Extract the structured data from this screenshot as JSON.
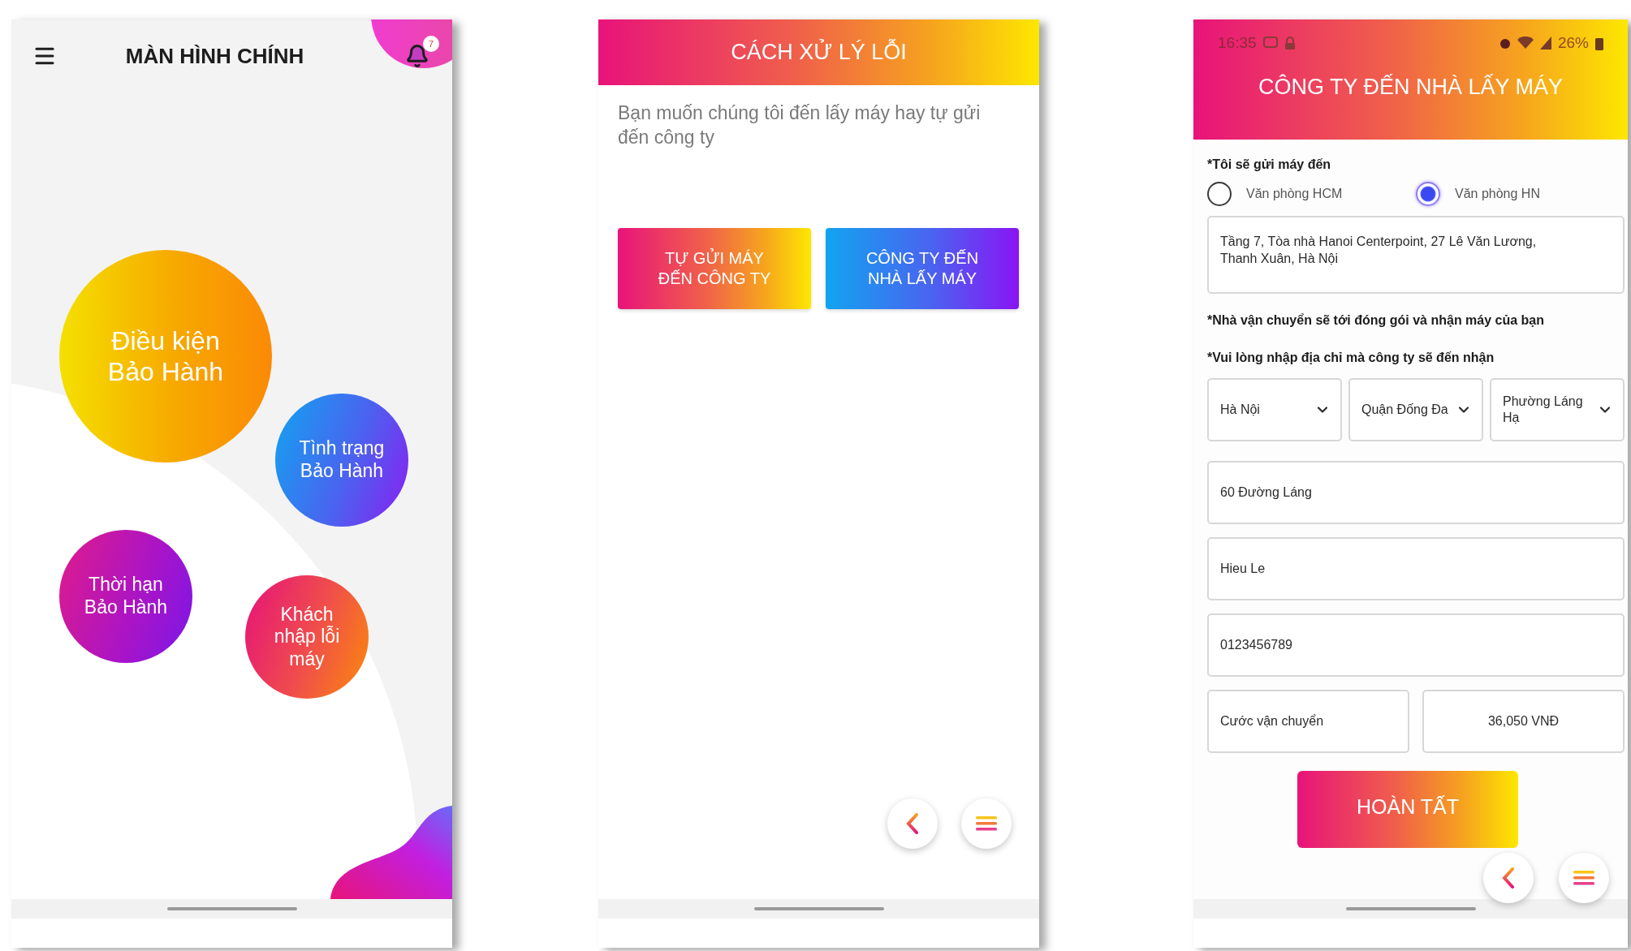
{
  "main_screen": {
    "title": "MÀN HÌNH CHÍNH",
    "notification_count": "7",
    "bubbles": [
      {
        "label": "Điều kiện Bảo Hành",
        "kind": "sunset"
      },
      {
        "label": "Tình trạng Bảo Hành",
        "kind": "ocean"
      },
      {
        "label": "Thời hạn Bảo Hành",
        "kind": "orchid"
      },
      {
        "label": "Khách nhập lỗi máy",
        "kind": "flame"
      }
    ]
  },
  "error_screen": {
    "title": "CÁCH XỬ LÝ LỖI",
    "prompt": "Bạn muốn chúng tôi đến lấy máy hay tự gửi đến công ty",
    "options": [
      {
        "label": "TỰ GỬI MÁY ĐẾN CÔNG TY",
        "kind": "warm"
      },
      {
        "label": "CÔNG TY ĐẾN NHÀ LẤY MÁY",
        "kind": "cool"
      }
    ]
  },
  "pickup_screen": {
    "status_bar": {
      "time": "16:35",
      "battery": "26%"
    },
    "title": "CÔNG TY ĐẾN NHÀ LẤY MÁY",
    "send_label": "*Tôi sẽ gửi máy đến",
    "offices": [
      {
        "label": "Văn phòng HCM",
        "selected": false
      },
      {
        "label": "Văn phòng HN",
        "selected": true
      }
    ],
    "office_address": "Tầng 7, Tòa nhà Hanoi Centerpoint, 27 Lê Văn Lương, Thanh Xuân, Hà Nội",
    "carrier_note": "*Nhà vận chuyển sẽ tới đóng gói và nhận máy của bạn",
    "address_note": "*Vui lòng nhập địa chỉ mà công ty sẽ đến nhận",
    "selects": [
      {
        "value": "Hà Nội"
      },
      {
        "value": "Quận Đống Đa"
      },
      {
        "value": "Phường Láng Hạ"
      }
    ],
    "fields": [
      {
        "value": "60 Đường Láng"
      },
      {
        "value": "Hieu Le"
      },
      {
        "value": "0123456789"
      }
    ],
    "fee": {
      "label": "Cước vận chuyển",
      "value": "36,050 VNĐ"
    },
    "submit": "HOÀN TẤT"
  }
}
